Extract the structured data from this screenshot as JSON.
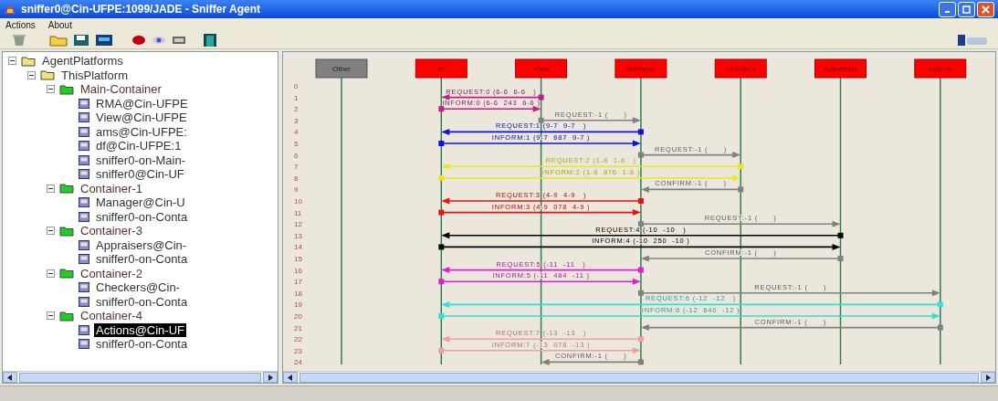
{
  "window": {
    "title": "sniffer0@Cin-UFPE:1099/JADE - Sniffer Agent"
  },
  "menu": [
    "Actions",
    "About"
  ],
  "tree": [
    {
      "label": "AgentPlatforms",
      "kind": "folder",
      "expanded": true,
      "children": [
        {
          "label": "ThisPlatform",
          "kind": "folder",
          "expanded": true,
          "children": [
            {
              "label": "Main-Container",
              "kind": "container",
              "expanded": true,
              "children": [
                {
                  "label": "RMA@Cin-UFPE",
                  "kind": "agent",
                  "selected": false
                },
                {
                  "label": "View@Cin-UFPE",
                  "kind": "agent",
                  "selected": false
                },
                {
                  "label": "ams@Cin-UFPE:",
                  "kind": "agent",
                  "selected": false
                },
                {
                  "label": "df@Cin-UFPE:1",
                  "kind": "agent",
                  "selected": false
                },
                {
                  "label": "sniffer0-on-Main-",
                  "kind": "agent",
                  "selected": false
                },
                {
                  "label": "sniffer0@Cin-UF",
                  "kind": "agent",
                  "selected": false
                }
              ]
            },
            {
              "label": "Container-1",
              "kind": "container",
              "expanded": true,
              "children": [
                {
                  "label": "Manager@Cin-U",
                  "kind": "agent",
                  "selected": false
                },
                {
                  "label": "sniffer0-on-Conta",
                  "kind": "agent",
                  "selected": false
                }
              ]
            },
            {
              "label": "Container-3",
              "kind": "container",
              "expanded": true,
              "children": [
                {
                  "label": "Appraisers@Cin-",
                  "kind": "agent",
                  "selected": false
                },
                {
                  "label": "sniffer0-on-Conta",
                  "kind": "agent",
                  "selected": false
                }
              ]
            },
            {
              "label": "Container-2",
              "kind": "container",
              "expanded": true,
              "children": [
                {
                  "label": "Checkers@Cin-",
                  "kind": "agent",
                  "selected": false
                },
                {
                  "label": "sniffer0-on-Conta",
                  "kind": "agent",
                  "selected": false
                }
              ]
            },
            {
              "label": "Container-4",
              "kind": "container",
              "expanded": true,
              "children": [
                {
                  "label": "Actions@Cin-UF",
                  "kind": "agent",
                  "selected": true
                },
                {
                  "label": "sniffer0-on-Conta",
                  "kind": "agent",
                  "selected": false
                }
              ]
            }
          ]
        }
      ]
    }
  ],
  "diagram": {
    "agents": [
      {
        "name": "Other",
        "kind": "other"
      },
      {
        "name": "df",
        "kind": "sniffed"
      },
      {
        "name": "View",
        "kind": "sniffed"
      },
      {
        "name": "Manager",
        "kind": "sniffed"
      },
      {
        "name": "Checkers",
        "kind": "sniffed"
      },
      {
        "name": "Appraisers",
        "kind": "sniffed"
      },
      {
        "name": "Actions",
        "kind": "sniffed"
      }
    ],
    "row_numbers": [
      "0",
      "1",
      "2",
      "3",
      "4",
      "5",
      "6",
      "7",
      "8",
      "9",
      "10",
      "11",
      "12",
      "13",
      "14",
      "15",
      "16",
      "17",
      "18",
      "19",
      "20",
      "21",
      "22",
      "23",
      "24"
    ],
    "messages": [
      {
        "kind": "viewDf",
        "label": "REQUEST:0 (6-6  6-6   )",
        "color": "#c0208a"
      },
      {
        "kind": "dfView",
        "label": "INFORM:0 (6-6  243  6-6 )",
        "color": "#c0208a"
      },
      {
        "kind": "viewManager",
        "label": "REQUEST:-1 (      )",
        "color": "#808080"
      },
      {
        "kind": "managerDf",
        "label": "REQUEST:1 (9-7  9-7   )",
        "color": "#1010e0"
      },
      {
        "kind": "dfManager",
        "label": "INFORM:1 (9-7  687  9-7 )",
        "color": "#1010e0"
      },
      {
        "kind": "managerCheckers",
        "label": "REQUEST:-1 (      )",
        "color": "#808080"
      },
      {
        "kind": "checkersDf",
        "label": "REQUEST:2 (1-8  1-8   )",
        "color": "#e8e820"
      },
      {
        "kind": "dfCheckers",
        "label": "INFORM:2 (1-8  876  1-8 )",
        "color": "#e8e820"
      },
      {
        "kind": "checkersManager",
        "label": "CONFIRM:-1 (      )",
        "color": "#808080"
      },
      {
        "kind": "managerDf",
        "label": "REQUEST:3 (4-9  4-9   )",
        "color": "#e81010"
      },
      {
        "kind": "dfManager",
        "label": "INFORM:3 (4-9  078  4-9 )",
        "color": "#e81010"
      },
      {
        "kind": "managerAppraisers",
        "label": "REQUEST:-1 (      )",
        "color": "#808080"
      },
      {
        "kind": "appraisersDf",
        "label": "REQUEST:4 (-10  -10   )",
        "color": "#000000"
      },
      {
        "kind": "dfAppraisers",
        "label": "INFORM:4 (-10  250  -10 )",
        "color": "#000000"
      },
      {
        "kind": "appraisersManager",
        "label": "CONFIRM:-1 (      )",
        "color": "#808080"
      },
      {
        "kind": "managerDf",
        "label": "REQUEST:5 (-11  -11   )",
        "color": "#e020d0"
      },
      {
        "kind": "dfManager",
        "label": "INFORM:5 (-11  484  -11 )",
        "color": "#e020d0"
      },
      {
        "kind": "managerActions",
        "label": "REQUEST:-1 (      )",
        "color": "#808080"
      },
      {
        "kind": "actionsDf",
        "label": "REQUEST:6 (-12  -12   )",
        "color": "#30e0d0"
      },
      {
        "kind": "dfActions",
        "label": "INFORM:6 (-12  640  -12 )",
        "color": "#30e0d0"
      },
      {
        "kind": "actionsManager",
        "label": "CONFIRM:-1 (      )",
        "color": "#808080"
      },
      {
        "kind": "managerDf",
        "label": "REQUEST:7 (-13  -13   )",
        "color": "#f0a0a0"
      },
      {
        "kind": "dfManager",
        "label": "INFORM:7 (-13  078  -13 )",
        "color": "#f0a0a0"
      },
      {
        "kind": "managerView",
        "label": "CONFIRM:-1 (      )",
        "color": "#808080"
      }
    ]
  }
}
